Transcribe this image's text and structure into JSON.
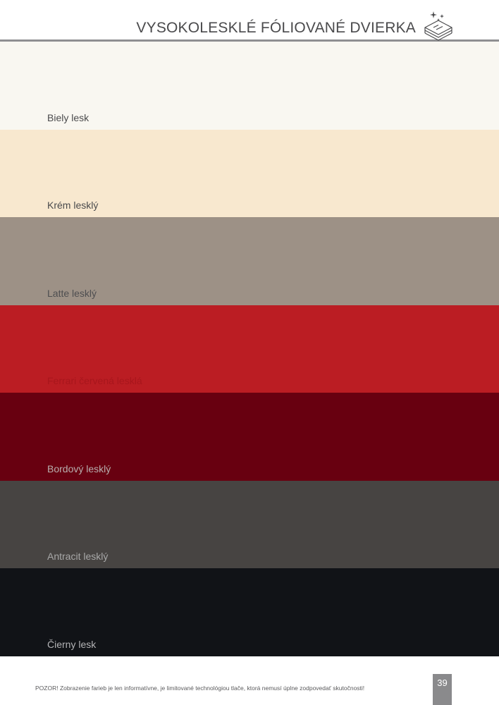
{
  "header": {
    "title": "VYSOKOLESKLÉ FÓLIOVANÉ DVIERKA",
    "icon": "glossy-layers-sparkle-icon"
  },
  "swatches": [
    {
      "label": "Biely lesk",
      "color": "#f9f7f1",
      "text_color": "#4a4a4c"
    },
    {
      "label": "Krém lesklý",
      "color": "#f8e8cf",
      "text_color": "#4a4a4c"
    },
    {
      "label": "Latte lesklý",
      "color": "#9d9186",
      "text_color": "#4e4e50"
    },
    {
      "label": "Ferrari červená lesklá",
      "color": "#bb1d23",
      "text_color": "#a8161c"
    },
    {
      "label": "Bordový lesklý",
      "color": "#680010",
      "text_color": "#b8aeae"
    },
    {
      "label": "Antracit lesklý",
      "color": "#474442",
      "text_color": "#a8a8a8"
    },
    {
      "label": "Čierny lesk",
      "color": "#111317",
      "text_color": "#b4b4b6"
    }
  ],
  "footer": {
    "note": "POZOR! Zobrazenie farieb je len informatívne, je limitované technológiou tlače, ktorá nemusí úplne zodpovedať skutočnosti!",
    "page_number": "39"
  }
}
